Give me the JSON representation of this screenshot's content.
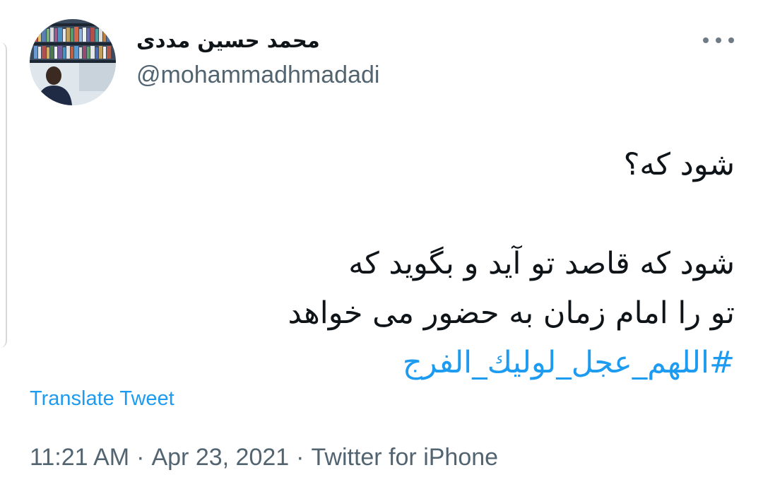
{
  "author": {
    "display_name": "محمد حسین مددی",
    "handle": "@mohammadhmadadi",
    "avatar": "profile-photo"
  },
  "menu": {
    "icon": "more-horizontal-icon"
  },
  "tweet": {
    "lines": [
      "شود که؟",
      "",
      "شود که قاصد تو آید و بگوید که",
      "تو را امام زمان به حضور می خواهد"
    ],
    "hashtag": "#اللهم_عجل_لوليك_الفرج"
  },
  "translate_label": "Translate Tweet",
  "meta": {
    "time": "11:21 AM",
    "separator": "·",
    "date": "Apr 23, 2021",
    "source": "Twitter for iPhone"
  },
  "colors": {
    "text": "#0f1419",
    "secondary": "#536471",
    "link": "#1d9bf0"
  }
}
